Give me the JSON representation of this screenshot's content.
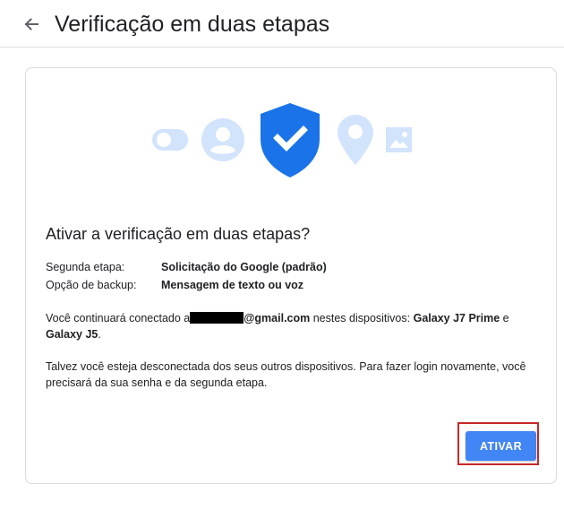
{
  "header": {
    "title": "Verificação em duas etapas",
    "back_icon": "arrow-left-icon"
  },
  "illustration": {
    "icons": [
      "toggle-icon",
      "account-icon",
      "shield-check-icon",
      "location-pin-icon",
      "image-icon"
    ],
    "colors": {
      "light": "#d2e3fc",
      "shield": "#1a73e8",
      "check": "#ffffff"
    }
  },
  "card": {
    "question": "Ativar a verificação em duas etapas?",
    "details": [
      {
        "label": "Segunda etapa:",
        "value": "Solicitação do Google (padrão)"
      },
      {
        "label": "Opção de backup:",
        "value": "Mensagem de texto ou voz"
      }
    ],
    "devices_text": {
      "prefix": "Você continuará conectado a",
      "email_suffix": "@gmail.com",
      "middle": " nestes dispositivos: ",
      "device1": "Galaxy J7 Prime",
      "conj": " e",
      "device2": "Galaxy J5",
      "end": "."
    },
    "warning": "Talvez você esteja desconectada dos seus outros dispositivos. Para fazer login novamente, você precisará da sua senha e da segunda etapa.",
    "button_label": "ATIVAR"
  },
  "colors": {
    "button": "#4285f4",
    "highlight": "#c62828",
    "border": "#dadce0"
  }
}
